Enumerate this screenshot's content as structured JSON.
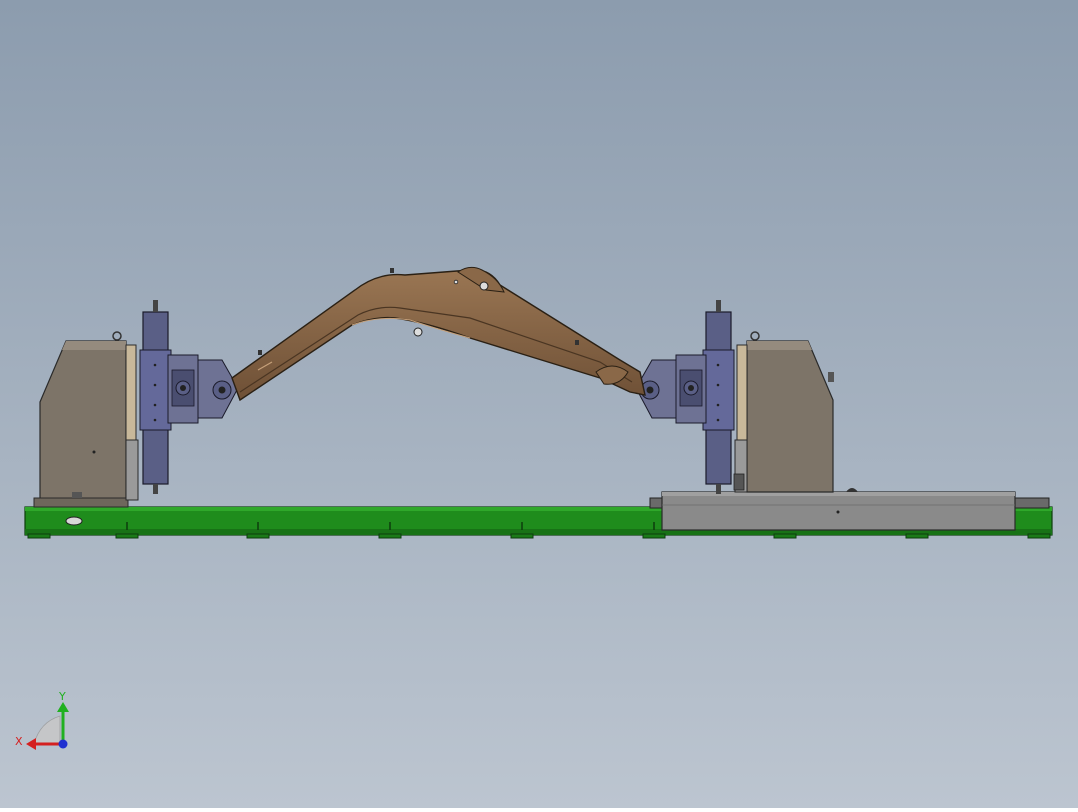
{
  "scene": {
    "background_top": "#8c9cae",
    "background_bottom": "#bcc5d0",
    "colors": {
      "base_frame": "#1f8c1c",
      "base_frame_dark": "#0f5a10",
      "headstock": "#7d7468",
      "tailstock_cover": "#8a8a8a",
      "faceplate": "#5a5f86",
      "clamp_block": "#6e7294",
      "workpiece_boom": "#7a5a3e",
      "workpiece_boom_light": "#9a7653",
      "outline": "#2a2a2a"
    }
  },
  "triad": {
    "x_label": "X",
    "y_label": "Y",
    "x_color": "#d42020",
    "y_color": "#20b020",
    "z_color": "#2030d0"
  }
}
